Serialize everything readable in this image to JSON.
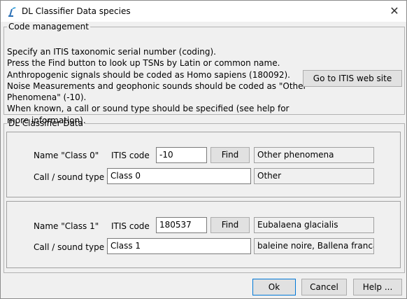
{
  "window": {
    "title": "DL Classifier Data species",
    "close_glyph": "✕",
    "icon": "pamguard-app-icon"
  },
  "code_management": {
    "legend": "Code management",
    "lines": [
      "Specify an ITIS taxonomic serial number (coding).",
      "Press the Find button to look up TSNs by Latin or common name.",
      "Anthropogenic signals should be coded as Homo sapiens (180092).",
      "Noise Measurements and geophonic sounds should be coded as \"Other",
      "Phenomena\" (-10).",
      "When known, a call or sound type should be specified (see help for",
      "more information)."
    ],
    "itis_button": "Go to ITIS web site"
  },
  "dl_classifier": {
    "legend": "DL Classifier Data",
    "classes": [
      {
        "name_label": "Name  \"Class 0\"",
        "itis_label": "ITIS code",
        "itis_code": "-10",
        "find_label": "Find",
        "species_name": "Other phenomena",
        "call_label": "Call / sound type",
        "call_type": "Class 0",
        "call_desc": "Other"
      },
      {
        "name_label": "Name  \"Class 1\"",
        "itis_label": "ITIS code",
        "itis_code": "180537",
        "find_label": "Find",
        "species_name": "Eubalaena glacialis",
        "call_label": "Call / sound type",
        "call_type": "Class 1",
        "call_desc": "baleine noire, Ballena franca"
      }
    ]
  },
  "buttons": {
    "ok": "Ok",
    "cancel": "Cancel",
    "help": "Help ..."
  }
}
